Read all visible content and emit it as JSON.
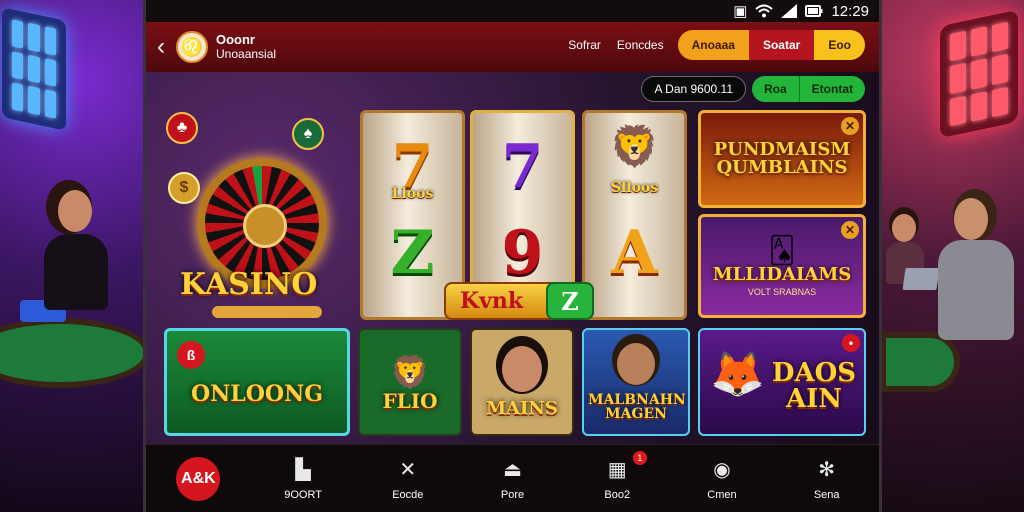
{
  "status": {
    "icons": [
      "nfc-icon",
      "wifi-icon",
      "signal-icon",
      "battery-icon"
    ],
    "time": "12:29"
  },
  "header": {
    "title": "Ooonr",
    "subtitle": "Unoaansial",
    "links": [
      "Sofrar",
      "Eoncdes"
    ],
    "pill": [
      "Anoaaa",
      "Soatar",
      "Eoo"
    ]
  },
  "subbar": {
    "account": "A Dan 9600.11",
    "buttons": [
      "Roa",
      "Etontat"
    ]
  },
  "games": {
    "roulette": {
      "title": "KASINO"
    },
    "reel1": {
      "top": "7",
      "label": "Lloos",
      "bottom": "Z"
    },
    "reel2": {
      "top": "7",
      "bottom": "9"
    },
    "reel3": {
      "label": "Slloos",
      "bottom": "A"
    },
    "win": {
      "label": "Kvnk",
      "go": "Z"
    },
    "featured1": {
      "title": "PUNDMAISM QUMBLAINS"
    },
    "featured2": {
      "title": "MLLIDAIAMS",
      "sub": "VOLT SRABNAS"
    },
    "card1": {
      "title": "ONLOONG"
    },
    "card2": {
      "title": "FLIO"
    },
    "card3": {
      "title": "MAINS"
    },
    "card4": {
      "title": "MALBNAHN MAGEN"
    },
    "card5": {
      "title": "DAOS AIN"
    }
  },
  "nav": {
    "home": "A&K",
    "items": [
      {
        "label": "9OORT",
        "icon": "store-icon"
      },
      {
        "label": "Eocde",
        "icon": "tools-icon"
      },
      {
        "label": "Pore",
        "icon": "bell-icon"
      },
      {
        "label": "Boo2",
        "icon": "calendar-icon",
        "badge": "1"
      },
      {
        "label": "Cmen",
        "icon": "target-icon"
      },
      {
        "label": "Sena",
        "icon": "gear-icon"
      }
    ]
  },
  "colors": {
    "header": "#7a0f14",
    "accent_orange": "#f2a21a",
    "accent_green": "#23b43a",
    "nav_home": "#d6161e"
  }
}
